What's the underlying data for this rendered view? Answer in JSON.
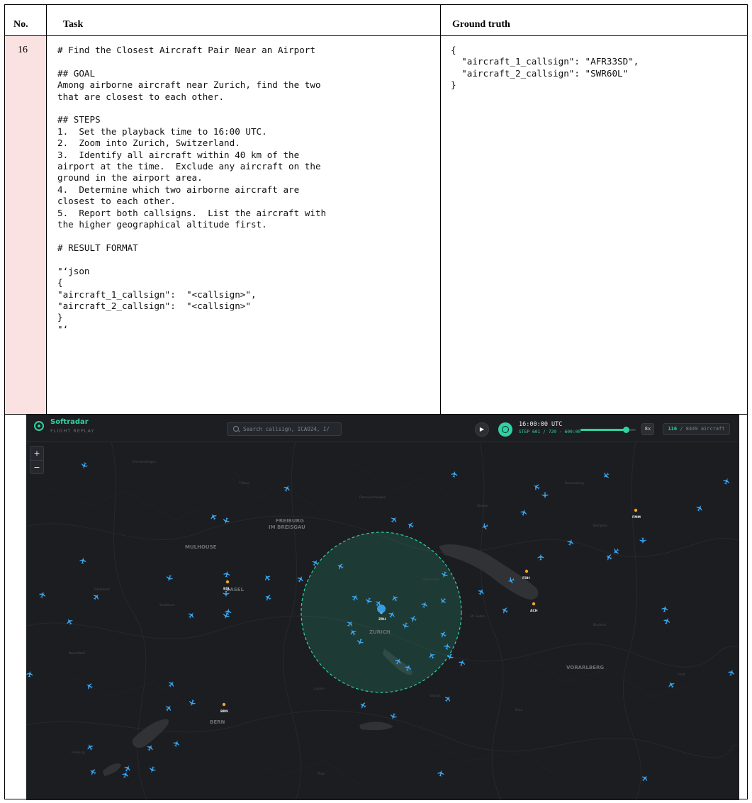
{
  "table": {
    "headers": {
      "no": "No.",
      "task": "Task",
      "truth": "Ground truth"
    },
    "row": {
      "no": "16",
      "task_text": "# Find the Closest Aircraft Pair Near an Airport\n\n## GOAL\nAmong airborne aircraft near Zurich, find the two\nthat are closest to each other.\n\n## STEPS\n1.  Set the playback time to 16:00 UTC.\n2.  Zoom into Zurich, Switzerland.\n3.  Identify all aircraft within 40 km of the\nairport at the time.  Exclude any aircraft on the\nground in the airport area.\n4.  Determine which two airborne aircraft are\nclosest to each other.\n5.  Report both callsigns.  List the aircraft with\nthe higher geographical altitude first.\n\n# RESULT FORMAT\n\n\"‘json\n{\n\"aircraft_1_callsign\":  \"<callsign>\",\n\"aircraft_2_callsign\":  \"<callsign>\"\n}\n\"‘",
      "truth_text": "{\n  \"aircraft_1_callsign\": \"AFR33SD\",\n  \"aircraft_2_callsign\": \"SWR60L\"\n}"
    }
  },
  "app": {
    "brand": "Softradar",
    "brand_sub": "FLIGHT REPLAY",
    "search_placeholder": "Search callsign, ICAO24, I/",
    "time": "16:00:00 UTC",
    "step": "STEP 601 / 720 · 600:00",
    "speed": "8x",
    "count_value": "116",
    "count_rest": " / 8449 aircraft",
    "progress": 0.83,
    "zoom_in": "+",
    "zoom_out": "−",
    "accent_color": "#2ed3a1",
    "aircraft_color": "#3aa8f5",
    "airport_color": "#f4a62a",
    "icons": [
      "search-icon",
      "play-icon",
      "live-target-icon",
      "aircraft-icon",
      "airport-marker-icon"
    ],
    "cities": [
      "FREIBURG\nIM BREISGAU",
      "MULHOUSE",
      "BASEL",
      "ZURICH",
      "BERN",
      "VORARLBERG"
    ],
    "airports": [
      "BSL",
      "ZRH",
      "BRN",
      "FDH",
      "ACH",
      "FMM"
    ]
  }
}
